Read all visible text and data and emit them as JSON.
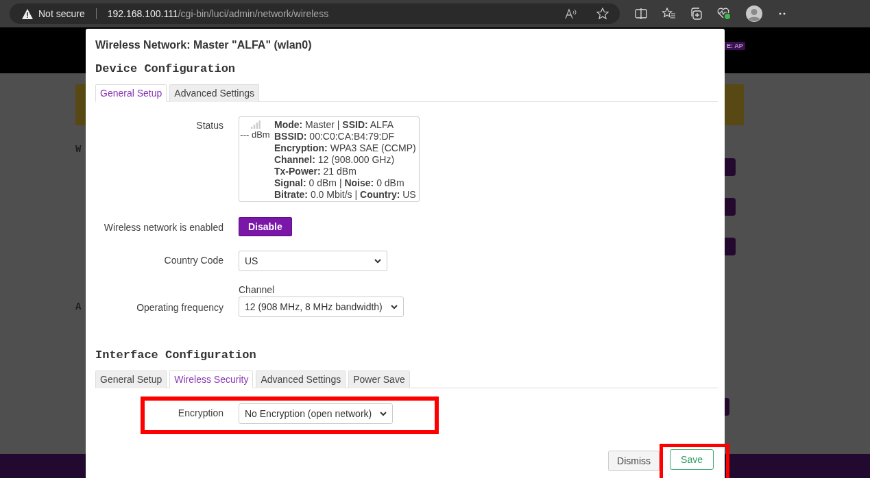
{
  "browser": {
    "security_label": "Not secure",
    "url_host": "192.168.100.111",
    "url_path": "/cgi-bin/luci/admin/network/wireless"
  },
  "background": {
    "badge": "E: AP",
    "left_letters": [
      "W",
      "A"
    ]
  },
  "dialog": {
    "title": "Wireless Network: Master \"ALFA\" (wlan0)",
    "sections": [
      {
        "title": "Device Configuration",
        "tabs": [
          {
            "label": "General Setup",
            "selected": true
          },
          {
            "label": "Advanced Settings",
            "selected": false
          }
        ],
        "fields": [
          {
            "kind": "status",
            "label": "Status",
            "signal_reading": "--- dBm",
            "lines": [
              "**Mode:** Master | **SSID:** ALFA",
              "**BSSID:** 00:C0:CA:B4:79:DF",
              "**Encryption:** WPA3 SAE (CCMP)",
              "**Channel:** 12 (908.000 GHz)",
              "**Tx-Power:** 21 dBm",
              "**Signal:** 0 dBm | **Noise:** 0 dBm",
              "**Bitrate:** 0.0 Mbit/s | **Country:** US"
            ]
          },
          {
            "kind": "button",
            "label": "Wireless network is enabled",
            "value": "Disable"
          },
          {
            "kind": "select",
            "label": "Country Code",
            "value": "US"
          },
          {
            "kind": "select",
            "label": "Operating frequency",
            "caption": "Channel",
            "value": "12 (908 MHz, 8 MHz bandwidth)"
          }
        ]
      },
      {
        "title": "Interface Configuration",
        "tabs": [
          {
            "label": "General Setup",
            "selected": false
          },
          {
            "label": "Wireless Security",
            "selected": true
          },
          {
            "label": "Advanced Settings",
            "selected": false
          },
          {
            "label": "Power Save",
            "selected": false
          }
        ],
        "fields": [
          {
            "kind": "select",
            "label": "Encryption",
            "value": "No Encryption (open network)",
            "highlighted": true
          }
        ]
      }
    ],
    "buttons": [
      {
        "label": "Dismiss",
        "kind": "neutral",
        "highlighted": false
      },
      {
        "label": "Save",
        "kind": "positive",
        "highlighted": true
      }
    ]
  }
}
